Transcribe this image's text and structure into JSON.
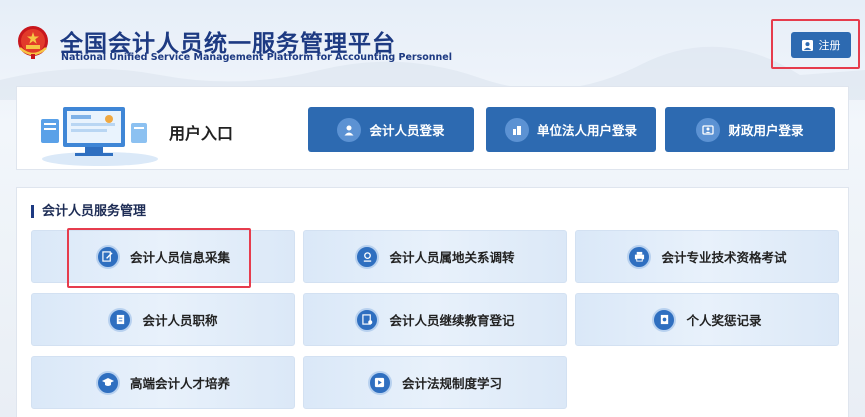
{
  "header": {
    "title_cn": "全国会计人员统一服务管理平台",
    "title_en": "National Unified Service Management Platform for Accounting Personnel",
    "register_label": "注册"
  },
  "entry": {
    "title": "用户入口",
    "buttons": [
      {
        "label": "会计人员登录",
        "icon": "person-icon"
      },
      {
        "label": "单位法人用户登录",
        "icon": "building-icon"
      },
      {
        "label": "财政用户登录",
        "icon": "id-card-icon"
      }
    ]
  },
  "services": {
    "title": "会计人员服务管理",
    "items": [
      {
        "label": "会计人员信息采集",
        "icon": "edit-form-icon"
      },
      {
        "label": "会计人员属地关系调转",
        "icon": "location-icon"
      },
      {
        "label": "会计专业技术资格考试",
        "icon": "printer-icon"
      },
      {
        "label": "会计人员职称",
        "icon": "document-icon"
      },
      {
        "label": "会计人员继续教育登记",
        "icon": "register-icon"
      },
      {
        "label": "个人奖惩记录",
        "icon": "record-icon"
      },
      {
        "label": "高端会计人才培养",
        "icon": "graduation-cap-icon"
      },
      {
        "label": "会计法规制度学习",
        "icon": "play-icon"
      }
    ]
  },
  "colors": {
    "primary": "#2d6ab1",
    "brand": "#1d3a82",
    "highlight": "#e63c4d"
  }
}
